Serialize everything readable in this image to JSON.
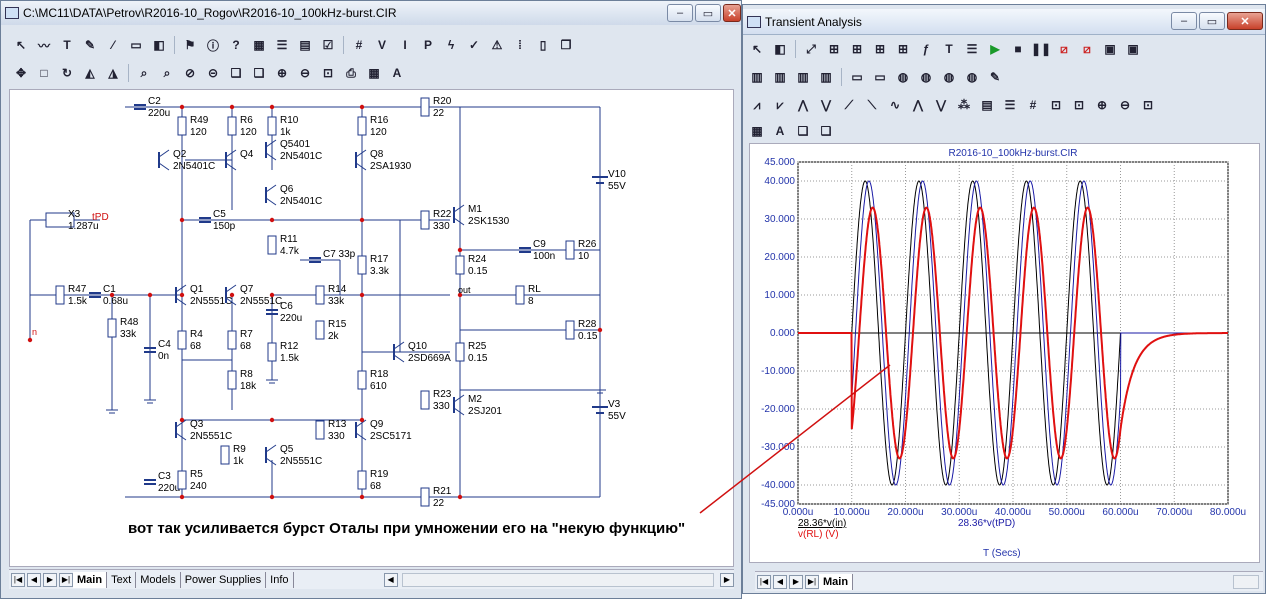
{
  "main_window": {
    "title": "C:\\MC11\\DATA\\Petrov\\R2016-10_Rogov\\R2016-10_100kHz-burst.CIR",
    "controls": {
      "minimize": "–",
      "maximize": "▭",
      "close": "✕"
    }
  },
  "schematic": {
    "components": [
      {
        "ref": "R49",
        "value": "120"
      },
      {
        "ref": "R6",
        "value": "120"
      },
      {
        "ref": "R10",
        "value": "1k"
      },
      {
        "ref": "R16",
        "value": "120"
      },
      {
        "ref": "R20",
        "value": "22"
      },
      {
        "ref": "C2",
        "value": "220u"
      },
      {
        "ref": "Q2",
        "value": "2N5401C"
      },
      {
        "ref": "Q4",
        "value": ""
      },
      {
        "ref": "Q5401",
        "value": "2N5401C"
      },
      {
        "ref": "Q8",
        "value": "2SA1930"
      },
      {
        "ref": "Q6",
        "value": "2N5401C"
      },
      {
        "ref": "V10",
        "value": "55V"
      },
      {
        "ref": "X3",
        "value": "1.287u"
      },
      {
        "ref": "C5",
        "value": "150p"
      },
      {
        "ref": "R22",
        "value": "330"
      },
      {
        "ref": "M1",
        "value": "2SK1530"
      },
      {
        "ref": "R11",
        "value": "4.7k"
      },
      {
        "ref": "C7 33p",
        "value": ""
      },
      {
        "ref": "C9",
        "value": "100n"
      },
      {
        "ref": "R26",
        "value": "10"
      },
      {
        "ref": "Q1",
        "value": "2N5551C"
      },
      {
        "ref": "Q7",
        "value": "2N5551C"
      },
      {
        "ref": "R17",
        "value": "3.3k"
      },
      {
        "ref": "R24",
        "value": "0.15"
      },
      {
        "ref": "R47",
        "value": "1.5k"
      },
      {
        "ref": "C1",
        "value": "0.68u"
      },
      {
        "ref": "R14",
        "value": "33k"
      },
      {
        "ref": "RL",
        "value": "8"
      },
      {
        "ref": "C6",
        "value": "220u"
      },
      {
        "ref": "R15",
        "value": "2k"
      },
      {
        "ref": "R48",
        "value": "33k"
      },
      {
        "ref": "C4",
        "value": "0n"
      },
      {
        "ref": "R28",
        "value": "0.15"
      },
      {
        "ref": "R4",
        "value": "68"
      },
      {
        "ref": "R7",
        "value": "68"
      },
      {
        "ref": "R12",
        "value": "1.5k"
      },
      {
        "ref": "Q10",
        "value": "2SD669A"
      },
      {
        "ref": "R25",
        "value": "0.15"
      },
      {
        "ref": "R18",
        "value": "610"
      },
      {
        "ref": "R8",
        "value": "18k"
      },
      {
        "ref": "R23",
        "value": "330"
      },
      {
        "ref": "M2",
        "value": "2SJ201"
      },
      {
        "ref": "V3",
        "value": "55V"
      },
      {
        "ref": "Q3",
        "value": "2N5551C"
      },
      {
        "ref": "R13",
        "value": "330"
      },
      {
        "ref": "Q9",
        "value": "2SC5171"
      },
      {
        "ref": "R9",
        "value": "1k"
      },
      {
        "ref": "Q5",
        "value": "2N5551C"
      },
      {
        "ref": "C3",
        "value": "220u"
      },
      {
        "ref": "R5",
        "value": "240"
      },
      {
        "ref": "R19",
        "value": "68"
      },
      {
        "ref": "R21",
        "value": "22"
      }
    ],
    "node_labels": {
      "tpd": "tPD",
      "out": "out",
      "in": "n"
    }
  },
  "annotation": "вот так усиливается бурст Оталы при умножении его на \"некую функцию\"",
  "tabs": [
    "Main",
    "Text",
    "Models",
    "Power Supplies",
    "Info"
  ],
  "transient_window": {
    "title": "Transient Analysis",
    "controls": {
      "minimize": "–",
      "maximize": "▭",
      "close": "✕"
    },
    "tab": "Main"
  },
  "chart_data": {
    "type": "line",
    "title": "R2016-10_100kHz-burst.CIR",
    "xlabel": "T (Secs)",
    "x_ticks": [
      "0.000u",
      "10.000u",
      "20.000u",
      "30.000u",
      "40.000u",
      "50.000u",
      "60.000u",
      "70.000u",
      "80.000u"
    ],
    "y_ticks": [
      "45.000",
      "40.000",
      "30.000",
      "20.000",
      "10.000",
      "0.000",
      "-10.000",
      "-20.000",
      "-30.000",
      "-40.000",
      "-45.000"
    ],
    "xlim": [
      0,
      80
    ],
    "x_unit": "u",
    "ylim": [
      -45,
      45
    ],
    "grid": true,
    "burst": {
      "start": 10,
      "end": 60,
      "frequency_mhz": 0.1
    },
    "legend_lines": [
      "28.36*v(in)",
      "28.36*v(tPD)",
      "v(RL) (V)"
    ],
    "series": [
      {
        "name": "28.36*v(in)",
        "color": "#000000",
        "amplitude": 40,
        "phase_deg": 0,
        "decay_us": 0
      },
      {
        "name": "28.36*v(tPD)",
        "color": "#1a1aa6",
        "amplitude": 40,
        "phase_deg": -25,
        "decay_us": 0
      },
      {
        "name": "v(RL) (V)",
        "color": "#e01010",
        "amplitude": 33,
        "phase_deg": -50,
        "decay_us": 2.5
      }
    ]
  }
}
